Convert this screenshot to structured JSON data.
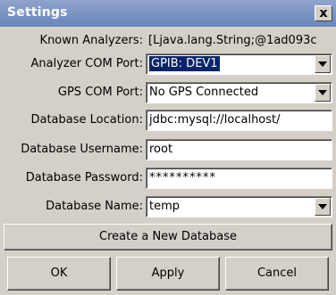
{
  "window": {
    "title": "Settings",
    "close_glyph": "x"
  },
  "fields": {
    "known_analyzers_label": "Known Analyzers:",
    "known_analyzers_value": "[Ljava.lang.String;@1ad093c",
    "analyzer_com_port_label": "Analyzer COM Port:",
    "analyzer_com_port_value": "GPIB: DEV1",
    "gps_com_port_label": "GPS COM Port:",
    "gps_com_port_value": "No GPS Connected",
    "database_location_label": "Database Location:",
    "database_location_value": "jdbc:mysql://localhost/",
    "database_username_label": "Database Username:",
    "database_username_value": "root",
    "database_password_label": "Database Password:",
    "database_password_value": "**********",
    "database_name_label": "Database Name:",
    "database_name_value": "temp"
  },
  "buttons": {
    "create_db": "Create a New Database",
    "ok": "OK",
    "apply": "Apply",
    "cancel": "Cancel"
  },
  "icons": {
    "close": "close-icon",
    "dropdown": "chevron-down-icon"
  },
  "colors": {
    "window_bg": "#d4d0c8",
    "titlebar": "#7a93c4",
    "selection": "#0a246a"
  }
}
